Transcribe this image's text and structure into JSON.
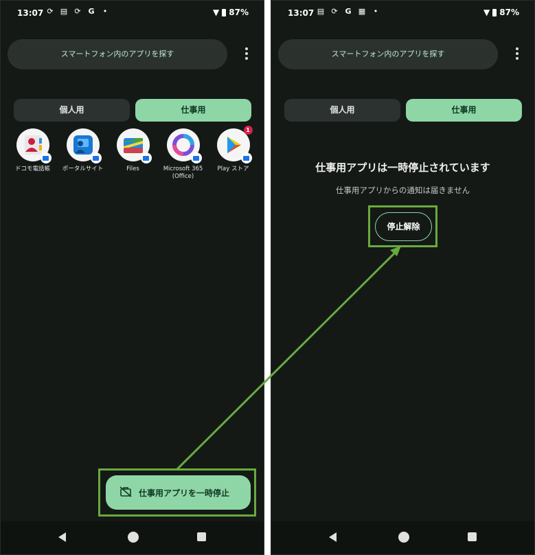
{
  "status": {
    "time": "13:07",
    "battery": "87%"
  },
  "left": {
    "search_placeholder": "スマートフォン内のアプリを探す",
    "tabs": {
      "personal": "個人用",
      "work": "仕事用"
    },
    "apps": [
      {
        "label": "ドコモ電話帳",
        "icon": "docomo-contacts-icon"
      },
      {
        "label": "ポータルサイト",
        "icon": "portal-site-icon"
      },
      {
        "label": "Files",
        "icon": "files-icon"
      },
      {
        "label": "Microsoft 365 (Office)",
        "icon": "microsoft365-icon"
      },
      {
        "label": "Play ストア",
        "icon": "play-store-icon",
        "badge": "1"
      }
    ],
    "fab_label": "仕事用アプリを一時停止"
  },
  "right": {
    "search_placeholder": "スマートフォン内のアプリを探す",
    "tabs": {
      "personal": "個人用",
      "work": "仕事用"
    },
    "paused_title": "仕事用アプリは一時停止されています",
    "paused_subtitle": "仕事用アプリからの通知は届きません",
    "unpause_label": "停止解除"
  },
  "colors": {
    "accent": "#8fd6a7",
    "highlight": "#6aaa3e",
    "background": "#141916"
  }
}
